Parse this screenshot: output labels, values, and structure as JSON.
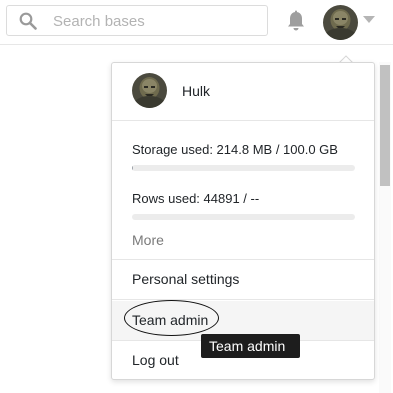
{
  "header": {
    "search": {
      "placeholder": "Search bases",
      "value": "",
      "icon": "search-icon"
    },
    "notifications": {
      "icon": "bell-icon"
    },
    "account_menu_icon": "chevron-down-icon"
  },
  "account_menu": {
    "user": {
      "name": "Hulk"
    },
    "storage": {
      "label": "Storage used: 214.8 MB / 100.0 GB",
      "used_fraction": 0.002
    },
    "rows": {
      "label": "Rows used: 44891 / --",
      "used_fraction": 0.0
    },
    "more_label": "More",
    "items": [
      {
        "label": "Personal settings"
      },
      {
        "label": "Team admin"
      },
      {
        "label": "Log out"
      }
    ]
  },
  "tooltip": {
    "text": "Team admin"
  },
  "colors": {
    "accent_bar": "#9aa0a6",
    "tooltip_bg": "#1d1d1d"
  }
}
